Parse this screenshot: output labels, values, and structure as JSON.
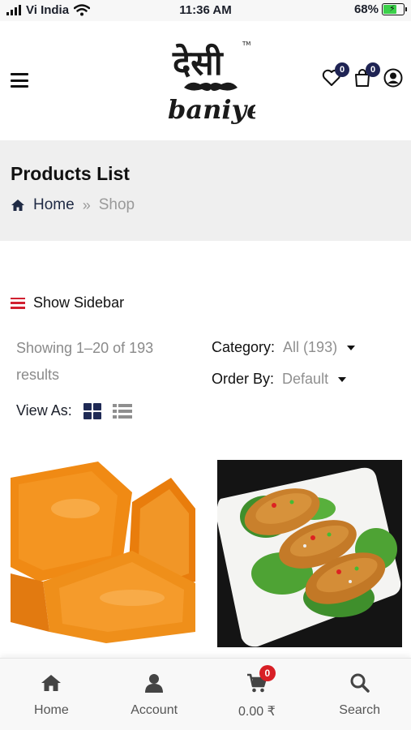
{
  "status_bar": {
    "carrier": "Vi India",
    "time": "11:36 AM",
    "battery": "68%",
    "battery_level": 0.68
  },
  "header": {
    "logo_line1": "देसी",
    "logo_tm": "TM",
    "logo_line2": "baniye",
    "wishlist_count": "0",
    "cart_count": "0"
  },
  "breadcrumb": {
    "title": "Products List",
    "home": "Home",
    "separator": "»",
    "current": "Shop"
  },
  "sidebar_toggle": {
    "label": "Show Sidebar"
  },
  "results": {
    "text": "Showing 1–20 of 193 results"
  },
  "filters": {
    "category_label": "Category:",
    "category_value": "All (193)",
    "order_label": "Order By:",
    "order_value": "Default"
  },
  "view": {
    "label": "View As:"
  },
  "products": [
    {
      "image": "orange-jelly-sweets"
    },
    {
      "image": "stuffed-cutlets-on-lettuce"
    }
  ],
  "bottom_nav": {
    "home": "Home",
    "account": "Account",
    "cart_total": "0.00 ₹",
    "cart_badge": "0",
    "search": "Search"
  },
  "colors": {
    "accent": "#1f2454",
    "badge_red": "#d81f26",
    "menu_red": "#d12030",
    "band_bg": "#efefef"
  }
}
